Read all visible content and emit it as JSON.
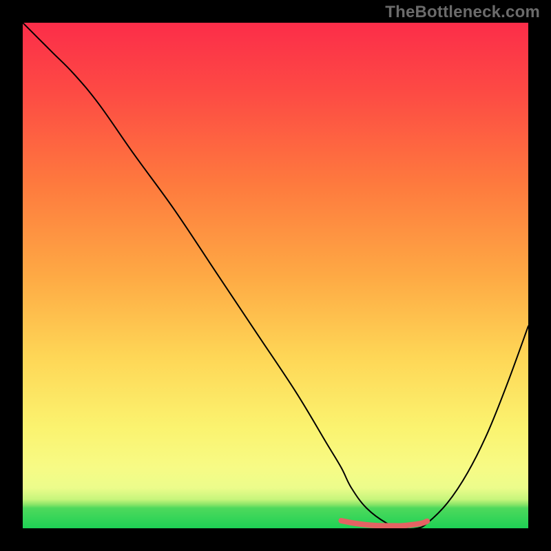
{
  "watermark": "TheBottleneck.com",
  "chart_data": {
    "type": "line",
    "title": "",
    "xlabel": "",
    "ylabel": "",
    "xlim": [
      0,
      100
    ],
    "ylim": [
      0,
      100
    ],
    "series": [
      {
        "name": "curve",
        "x": [
          0,
          3,
          6,
          10,
          15,
          22,
          30,
          38,
          46,
          54,
          60,
          63,
          65,
          68,
          72,
          75,
          78,
          80,
          84,
          88,
          92,
          96,
          100
        ],
        "y": [
          100,
          97,
          94,
          90,
          84,
          74,
          63,
          51,
          39,
          27,
          17,
          12,
          8,
          4,
          1,
          0,
          0,
          1,
          5,
          11,
          19,
          29,
          40
        ]
      },
      {
        "name": "optimal-band",
        "x": [
          63,
          65,
          67,
          69,
          71,
          73,
          75,
          77,
          79,
          80
        ],
        "y": [
          1.5,
          1.1,
          0.8,
          0.6,
          0.5,
          0.5,
          0.5,
          0.7,
          1.0,
          1.4
        ]
      }
    ],
    "gradient_bands": [
      {
        "y": 95.5,
        "h": 4.5,
        "color": "#2bd659"
      },
      {
        "y": 92.0,
        "h": 3.5,
        "color": "#a8ec6b"
      },
      {
        "y": 86.0,
        "h": 6.0,
        "color": "#f4fb87"
      },
      {
        "y": 72.0,
        "h": 14.0,
        "color": "#fdee66"
      },
      {
        "y": 52.0,
        "h": 20.0,
        "color": "#fec64a"
      },
      {
        "y": 30.0,
        "h": 22.0,
        "color": "#fe903f"
      },
      {
        "y": 10.0,
        "h": 20.0,
        "color": "#fd5b41"
      },
      {
        "y": 0.0,
        "h": 10.0,
        "color": "#fc3347"
      }
    ],
    "colors": {
      "curve": "#000000",
      "optimal": "#e46363",
      "frame_bg": "#000000"
    }
  }
}
